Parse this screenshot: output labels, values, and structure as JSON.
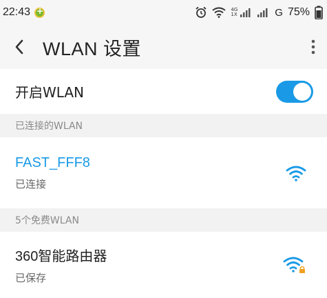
{
  "status_bar": {
    "time": "22:43",
    "network_small_top": "4G",
    "network_small_bottom": "1X",
    "carrier_type": "G",
    "battery": "75%"
  },
  "header": {
    "title": "WLAN 设置"
  },
  "wlan_toggle": {
    "label": "开启WLAN",
    "enabled": true
  },
  "sections": {
    "connected_header": "已连接的WLAN",
    "free_header": "5个免费WLAN"
  },
  "networks": {
    "connected": {
      "name": "FAST_FFF8",
      "status": "已连接"
    },
    "saved": {
      "name": "360智能路由器",
      "status": "已保存"
    }
  },
  "colors": {
    "accent": "#1a9ae6",
    "lock": "#f0a020"
  }
}
